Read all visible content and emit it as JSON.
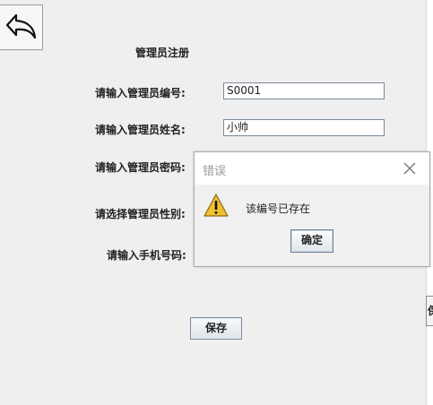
{
  "form": {
    "title": "管理员注册",
    "id_label": "请输入管理员编号:",
    "id_value": "S0001",
    "name_label": "请输入管理员姓名:",
    "name_value": "小帅",
    "password_label": "请输入管理员密码:",
    "gender_label": "请选择管理员性别:",
    "phone_label": "请输入手机号码:",
    "save_label": "保存",
    "edge_button_char": "保"
  },
  "dialog": {
    "title": "错误",
    "message": "该编号已存在",
    "ok_label": "确定",
    "icon": "warning-icon",
    "icon_color": "#f2c12e"
  },
  "icons": {
    "back": "back-arrow-icon",
    "close": "close-icon"
  }
}
